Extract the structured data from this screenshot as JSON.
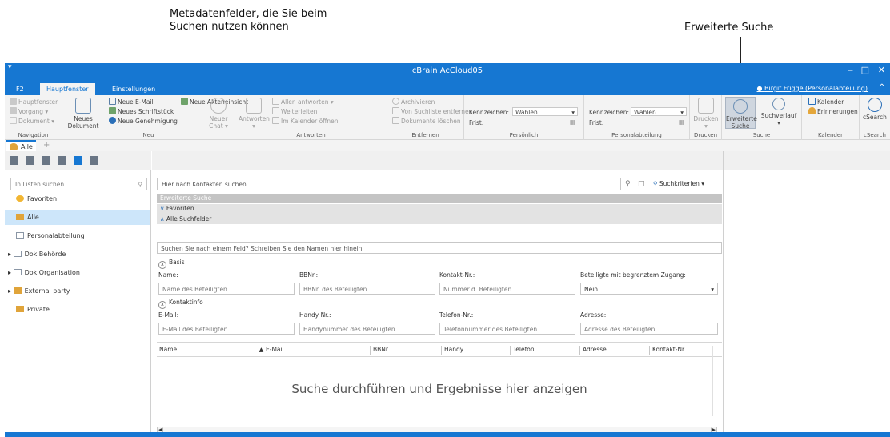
{
  "callouts": {
    "metadata_line1": "Metadatenfelder, die Sie beim",
    "metadata_line2": "Suchen nutzen können",
    "advanced": "Erweiterte Suche"
  },
  "window": {
    "title": "cBrain AcCloud05",
    "quick_access": "▾",
    "minimize": "‒",
    "maximize": "□",
    "close": "✕"
  },
  "ribbon_tabs": [
    "F2",
    "Hauptfenster",
    "Einstellungen"
  ],
  "active_tab": "Hauptfenster",
  "user": "Birgit Frigge (Personalabteilung)",
  "collapse_icon": "^",
  "ribbon": {
    "navigation": {
      "label": "Navigation",
      "items": [
        "Hauptfenster",
        "Vorgang ▾",
        "Dokument ▾"
      ]
    },
    "neu": {
      "label": "Neu",
      "big_button": [
        "Neues",
        "Dokument"
      ],
      "items": [
        "Neue E-Mail",
        "Neues Schriftstück",
        "Neue Genehmigung",
        "Neue Akteneinsicht"
      ],
      "chat": [
        "Neuer",
        "Chat ▾"
      ]
    },
    "antworten": {
      "label": "Antworten",
      "big_button": [
        "Antworten",
        "▾"
      ],
      "items": [
        "Allen antworten ▾",
        "Weiterleiten",
        "Im Kalender öffnen"
      ]
    },
    "entfernen": {
      "label": "Entfernen",
      "items": [
        "Archivieren",
        "Von Suchliste entfernen",
        "Dokumente löschen"
      ]
    },
    "persoenlich": {
      "label": "Persönlich",
      "kennzeichen_label": "Kennzeichen:",
      "kennzeichen_value": "Wählen",
      "frist_label": "Frist:"
    },
    "personalabteilung": {
      "label": "Personalabteilung",
      "kennzeichen_label": "Kennzeichen:",
      "kennzeichen_value": "Wählen",
      "frist_label": "Frist:"
    },
    "drucken": {
      "label": "Drucken",
      "button": [
        "Drucken",
        "▾"
      ]
    },
    "suche": {
      "label": "Suche",
      "advanced": [
        "Erweiterte",
        "Suche"
      ],
      "history": [
        "Suchverlauf",
        "▾"
      ]
    },
    "kalender": {
      "label": "Kalender",
      "items": [
        "Kalender",
        "Erinnerungen"
      ]
    },
    "csearch": {
      "label": "cSearch",
      "button": "cSearch"
    }
  },
  "doc_tabs": {
    "active": "Alle",
    "add": "+"
  },
  "sidebar": {
    "search_placeholder": "In Listen suchen",
    "items": [
      {
        "label": "Favoriten",
        "expander": ""
      },
      {
        "label": "Alle",
        "expander": ""
      },
      {
        "label": "Personalabteilung",
        "expander": ""
      },
      {
        "label": "Dok Behörde",
        "expander": "▸"
      },
      {
        "label": "Dok Organisation",
        "expander": "▸"
      },
      {
        "label": "External party",
        "expander": "▸"
      },
      {
        "label": "Private",
        "expander": ""
      }
    ]
  },
  "main": {
    "search_placeholder": "Hier nach Kontakten suchen",
    "criteria_button": "Suchkriterien ▾",
    "advanced_header": "Erweiterte Suche",
    "favorites_header": "Favoriten",
    "all_fields_header": "Alle Suchfelder",
    "field_search_placeholder": "Suchen Sie nach einem Feld? Schreiben Sie den Namen hier hinein",
    "basis": {
      "title": "Basis",
      "fields": [
        {
          "label": "Name:",
          "placeholder": "Name des Beteiligten"
        },
        {
          "label": "BBNr.:",
          "placeholder": "BBNr. des Beteiligten"
        },
        {
          "label": "Kontakt-Nr.:",
          "placeholder": "Nummer d. Beteiligten"
        },
        {
          "label": "Beteiligte mit begrenztem Zugang:",
          "placeholder": "Nein"
        }
      ]
    },
    "kontaktinfo": {
      "title": "Kontaktinfo",
      "fields": [
        {
          "label": "E-Mail:",
          "placeholder": "E-Mail des Beteiligten"
        },
        {
          "label": "Handy Nr.:",
          "placeholder": "Handynummer des Beteiligten"
        },
        {
          "label": "Telefon-Nr.:",
          "placeholder": "Telefonnummer des Beteiligten"
        },
        {
          "label": "Adresse:",
          "placeholder": "Adresse des Beteiligten"
        }
      ]
    },
    "columns": [
      "Name",
      "E-Mail",
      "BBNr.",
      "Handy",
      "Telefon",
      "Adresse",
      "Kontakt-Nr."
    ],
    "empty_message": "Suche durchführen und Ergebnisse hier anzeigen"
  },
  "colors": {
    "brand": "#1677d2",
    "ribbon": "#f3f3f3",
    "selected": "#cde6fa"
  }
}
